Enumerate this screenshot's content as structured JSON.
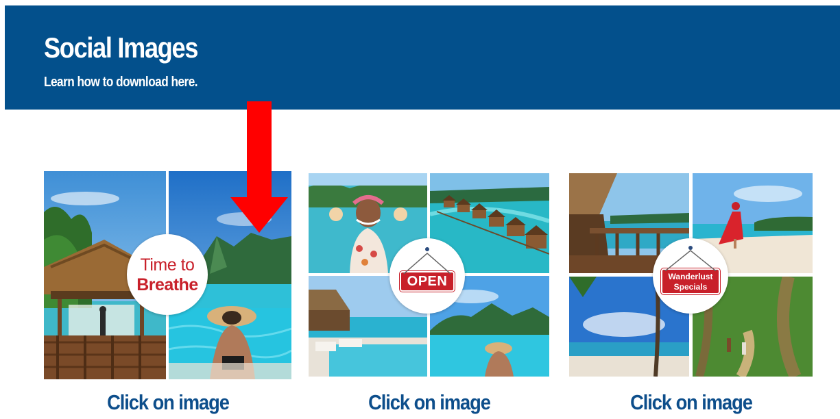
{
  "header": {
    "title": "Social Images",
    "subtitle": "Learn how to download here."
  },
  "cards": [
    {
      "badge_line1": "Time to",
      "badge_line2": "Breathe",
      "caption": "Click on image"
    },
    {
      "badge": "OPEN",
      "caption": "Click on image"
    },
    {
      "badge_line1": "Wanderlust",
      "badge_line2": "Specials",
      "caption": "Click on image"
    }
  ],
  "colors": {
    "banner": "#03508c",
    "caption": "#0d4e8b",
    "badge_red": "#c8202a",
    "arrow": "#ff0000"
  }
}
